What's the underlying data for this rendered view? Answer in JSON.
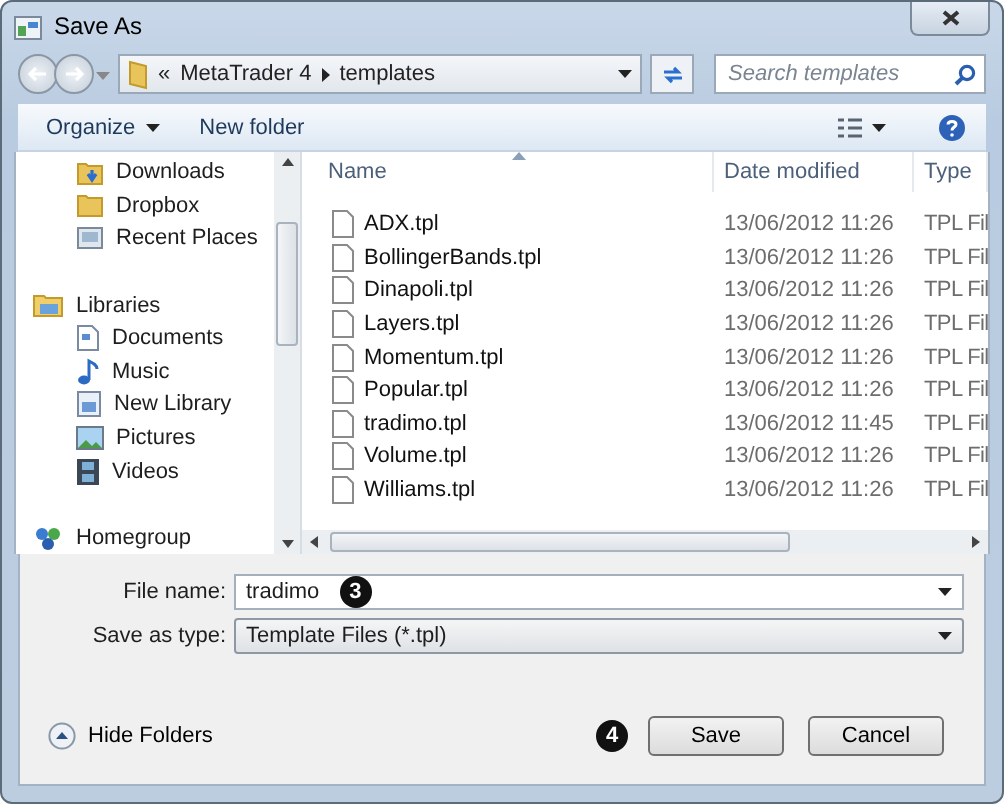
{
  "window": {
    "title": "Save As"
  },
  "address": {
    "overflow_mark": "«",
    "crumbs": [
      "MetaTrader 4",
      "templates"
    ]
  },
  "search": {
    "placeholder": "Search templates"
  },
  "toolbar": {
    "buttons": [
      {
        "label": "Organize",
        "dropdown": true
      },
      {
        "label": "New folder",
        "dropdown": false
      }
    ]
  },
  "nav_pane": {
    "favorites_tail": [
      {
        "label": "Downloads",
        "kind": "downloads"
      },
      {
        "label": "Dropbox",
        "kind": "folder"
      },
      {
        "label": "Recent Places",
        "kind": "recent"
      }
    ],
    "tree": [
      {
        "label": "Libraries",
        "kind": "libraries",
        "children": [
          {
            "label": "Documents",
            "kind": "documents"
          },
          {
            "label": "Music",
            "kind": "music"
          },
          {
            "label": "New Library",
            "kind": "library"
          },
          {
            "label": "Pictures",
            "kind": "pictures"
          },
          {
            "label": "Videos",
            "kind": "videos"
          }
        ]
      },
      {
        "label": "Homegroup",
        "kind": "homegroup"
      }
    ]
  },
  "file_list": {
    "columns": [
      "Name",
      "Date modified",
      "Type"
    ],
    "rows": [
      {
        "name": "ADX.tpl",
        "date": "13/06/2012 11:26",
        "type": "TPL Fil"
      },
      {
        "name": "BollingerBands.tpl",
        "date": "13/06/2012 11:26",
        "type": "TPL Fil"
      },
      {
        "name": "Dinapoli.tpl",
        "date": "13/06/2012 11:26",
        "type": "TPL Fil"
      },
      {
        "name": "Layers.tpl",
        "date": "13/06/2012 11:26",
        "type": "TPL Fil"
      },
      {
        "name": "Momentum.tpl",
        "date": "13/06/2012 11:26",
        "type": "TPL Fil"
      },
      {
        "name": "Popular.tpl",
        "date": "13/06/2012 11:26",
        "type": "TPL Fil"
      },
      {
        "name": "tradimo.tpl",
        "date": "13/06/2012 11:45",
        "type": "TPL Fil"
      },
      {
        "name": "Volume.tpl",
        "date": "13/06/2012 11:26",
        "type": "TPL Fil"
      },
      {
        "name": "Williams.tpl",
        "date": "13/06/2012 11:26",
        "type": "TPL Fil"
      }
    ]
  },
  "form": {
    "file_name": {
      "label": "File name:",
      "value": "tradimo",
      "callout": "3"
    },
    "save_type": {
      "label": "Save as type:",
      "value": "Template Files (*.tpl)"
    }
  },
  "footer": {
    "hide_folders": "Hide Folders",
    "callout": "4",
    "buttons": [
      "Save",
      "Cancel"
    ]
  }
}
